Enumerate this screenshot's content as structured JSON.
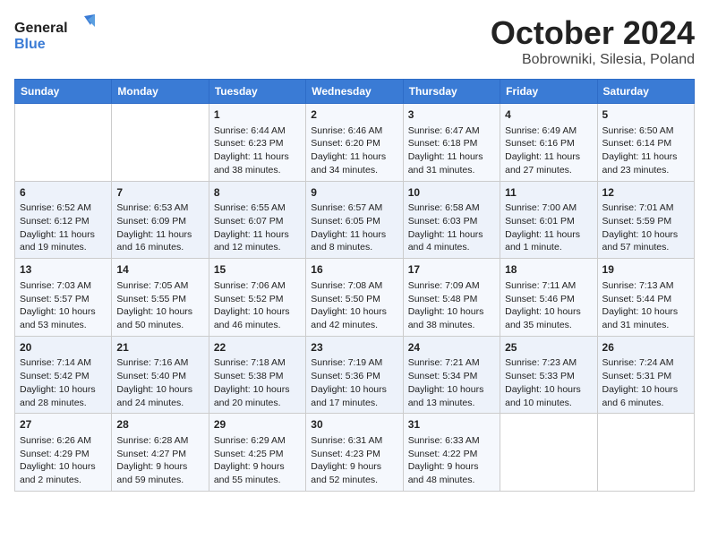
{
  "header": {
    "logo_general": "General",
    "logo_blue": "Blue",
    "month": "October 2024",
    "location": "Bobrowniki, Silesia, Poland"
  },
  "days_of_week": [
    "Sunday",
    "Monday",
    "Tuesday",
    "Wednesday",
    "Thursday",
    "Friday",
    "Saturday"
  ],
  "weeks": [
    [
      {
        "day": "",
        "content": ""
      },
      {
        "day": "",
        "content": ""
      },
      {
        "day": "1",
        "content": "Sunrise: 6:44 AM\nSunset: 6:23 PM\nDaylight: 11 hours and 38 minutes."
      },
      {
        "day": "2",
        "content": "Sunrise: 6:46 AM\nSunset: 6:20 PM\nDaylight: 11 hours and 34 minutes."
      },
      {
        "day": "3",
        "content": "Sunrise: 6:47 AM\nSunset: 6:18 PM\nDaylight: 11 hours and 31 minutes."
      },
      {
        "day": "4",
        "content": "Sunrise: 6:49 AM\nSunset: 6:16 PM\nDaylight: 11 hours and 27 minutes."
      },
      {
        "day": "5",
        "content": "Sunrise: 6:50 AM\nSunset: 6:14 PM\nDaylight: 11 hours and 23 minutes."
      }
    ],
    [
      {
        "day": "6",
        "content": "Sunrise: 6:52 AM\nSunset: 6:12 PM\nDaylight: 11 hours and 19 minutes."
      },
      {
        "day": "7",
        "content": "Sunrise: 6:53 AM\nSunset: 6:09 PM\nDaylight: 11 hours and 16 minutes."
      },
      {
        "day": "8",
        "content": "Sunrise: 6:55 AM\nSunset: 6:07 PM\nDaylight: 11 hours and 12 minutes."
      },
      {
        "day": "9",
        "content": "Sunrise: 6:57 AM\nSunset: 6:05 PM\nDaylight: 11 hours and 8 minutes."
      },
      {
        "day": "10",
        "content": "Sunrise: 6:58 AM\nSunset: 6:03 PM\nDaylight: 11 hours and 4 minutes."
      },
      {
        "day": "11",
        "content": "Sunrise: 7:00 AM\nSunset: 6:01 PM\nDaylight: 11 hours and 1 minute."
      },
      {
        "day": "12",
        "content": "Sunrise: 7:01 AM\nSunset: 5:59 PM\nDaylight: 10 hours and 57 minutes."
      }
    ],
    [
      {
        "day": "13",
        "content": "Sunrise: 7:03 AM\nSunset: 5:57 PM\nDaylight: 10 hours and 53 minutes."
      },
      {
        "day": "14",
        "content": "Sunrise: 7:05 AM\nSunset: 5:55 PM\nDaylight: 10 hours and 50 minutes."
      },
      {
        "day": "15",
        "content": "Sunrise: 7:06 AM\nSunset: 5:52 PM\nDaylight: 10 hours and 46 minutes."
      },
      {
        "day": "16",
        "content": "Sunrise: 7:08 AM\nSunset: 5:50 PM\nDaylight: 10 hours and 42 minutes."
      },
      {
        "day": "17",
        "content": "Sunrise: 7:09 AM\nSunset: 5:48 PM\nDaylight: 10 hours and 38 minutes."
      },
      {
        "day": "18",
        "content": "Sunrise: 7:11 AM\nSunset: 5:46 PM\nDaylight: 10 hours and 35 minutes."
      },
      {
        "day": "19",
        "content": "Sunrise: 7:13 AM\nSunset: 5:44 PM\nDaylight: 10 hours and 31 minutes."
      }
    ],
    [
      {
        "day": "20",
        "content": "Sunrise: 7:14 AM\nSunset: 5:42 PM\nDaylight: 10 hours and 28 minutes."
      },
      {
        "day": "21",
        "content": "Sunrise: 7:16 AM\nSunset: 5:40 PM\nDaylight: 10 hours and 24 minutes."
      },
      {
        "day": "22",
        "content": "Sunrise: 7:18 AM\nSunset: 5:38 PM\nDaylight: 10 hours and 20 minutes."
      },
      {
        "day": "23",
        "content": "Sunrise: 7:19 AM\nSunset: 5:36 PM\nDaylight: 10 hours and 17 minutes."
      },
      {
        "day": "24",
        "content": "Sunrise: 7:21 AM\nSunset: 5:34 PM\nDaylight: 10 hours and 13 minutes."
      },
      {
        "day": "25",
        "content": "Sunrise: 7:23 AM\nSunset: 5:33 PM\nDaylight: 10 hours and 10 minutes."
      },
      {
        "day": "26",
        "content": "Sunrise: 7:24 AM\nSunset: 5:31 PM\nDaylight: 10 hours and 6 minutes."
      }
    ],
    [
      {
        "day": "27",
        "content": "Sunrise: 6:26 AM\nSunset: 4:29 PM\nDaylight: 10 hours and 2 minutes."
      },
      {
        "day": "28",
        "content": "Sunrise: 6:28 AM\nSunset: 4:27 PM\nDaylight: 9 hours and 59 minutes."
      },
      {
        "day": "29",
        "content": "Sunrise: 6:29 AM\nSunset: 4:25 PM\nDaylight: 9 hours and 55 minutes."
      },
      {
        "day": "30",
        "content": "Sunrise: 6:31 AM\nSunset: 4:23 PM\nDaylight: 9 hours and 52 minutes."
      },
      {
        "day": "31",
        "content": "Sunrise: 6:33 AM\nSunset: 4:22 PM\nDaylight: 9 hours and 48 minutes."
      },
      {
        "day": "",
        "content": ""
      },
      {
        "day": "",
        "content": ""
      }
    ]
  ]
}
